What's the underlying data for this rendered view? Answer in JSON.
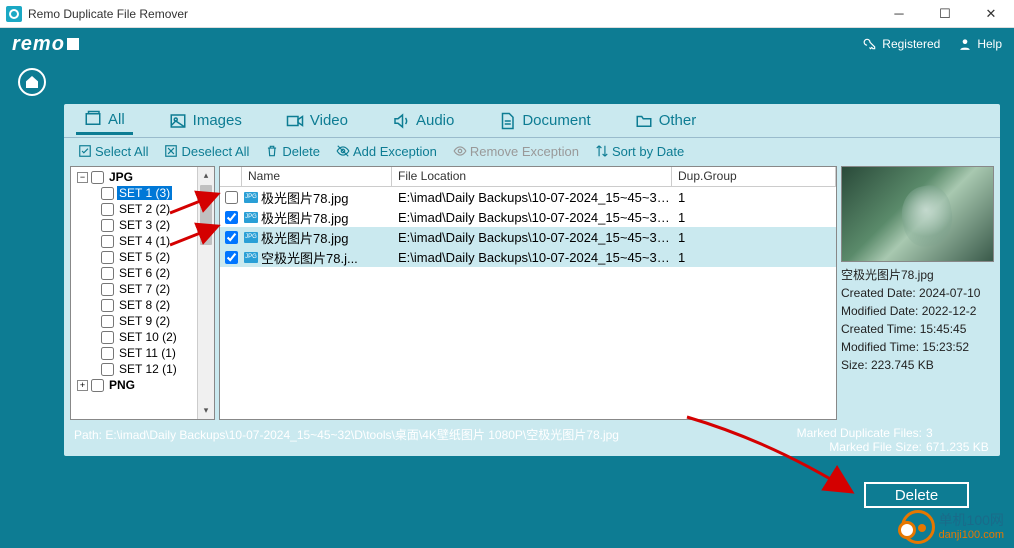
{
  "window": {
    "title": "Remo Duplicate File Remover"
  },
  "header": {
    "logo": "remo",
    "registered": "Registered",
    "help": "Help"
  },
  "tabs": {
    "all": "All",
    "images": "Images",
    "video": "Video",
    "audio": "Audio",
    "document": "Document",
    "other": "Other"
  },
  "toolbar": {
    "select_all": "Select All",
    "deselect_all": "Deselect All",
    "delete": "Delete",
    "add_exception": "Add Exception",
    "remove_exception": "Remove Exception",
    "sort_by_date": "Sort by Date"
  },
  "tree": {
    "root": "JPG",
    "items": [
      {
        "label": "SET 1 (3)",
        "selected": true
      },
      {
        "label": "SET 2 (2)"
      },
      {
        "label": "SET 3 (2)"
      },
      {
        "label": "SET 4 (1)"
      },
      {
        "label": "SET 5 (2)"
      },
      {
        "label": "SET 6 (2)"
      },
      {
        "label": "SET 7 (2)"
      },
      {
        "label": "SET 8 (2)"
      },
      {
        "label": "SET 9 (2)"
      },
      {
        "label": "SET 10 (2)"
      },
      {
        "label": "SET 11 (1)"
      },
      {
        "label": "SET 12 (1)"
      }
    ],
    "last": "PNG"
  },
  "filelist": {
    "headers": {
      "name": "Name",
      "location": "File Location",
      "group": "Dup.Group"
    },
    "rows": [
      {
        "checked": false,
        "name": "极光图片78.jpg",
        "loc": "E:\\imad\\Daily Backups\\10-07-2024_15~45~32\\...",
        "grp": "1",
        "sel": false
      },
      {
        "checked": true,
        "name": "极光图片78.jpg",
        "loc": "E:\\imad\\Daily Backups\\10-07-2024_15~45~32\\...",
        "grp": "1",
        "sel": false
      },
      {
        "checked": true,
        "name": "极光图片78.jpg",
        "loc": "E:\\imad\\Daily Backups\\10-07-2024_15~45~32\\...",
        "grp": "1",
        "sel": true
      },
      {
        "checked": true,
        "name": "空极光图片78.j...",
        "loc": "E:\\imad\\Daily Backups\\10-07-2024_15~45~32\\...",
        "grp": "1",
        "sel": true
      }
    ]
  },
  "preview": {
    "filename": "空极光图片78.jpg",
    "created_date": "Created Date: 2024-07-10",
    "modified_date": "Modified Date: 2022-12-2",
    "created_time": "Created Time: 15:45:45",
    "modified_time": "Modified Time: 15:23:52",
    "size": "Size: 223.745 KB"
  },
  "footer": {
    "path_label": "Path:",
    "path": "E:\\imad\\Daily Backups\\10-07-2024_15~45~32\\D\\tools\\桌面\\4K壁纸图片 1080P\\空极光图片78.jpg",
    "marked_files_label": "Marked Duplicate Files:",
    "marked_files": "3",
    "marked_size_label": "Marked File Size:",
    "marked_size": "671.235 KB"
  },
  "buttons": {
    "delete": "Delete"
  },
  "watermark": {
    "line1": "单机100网",
    "line2": "danji100.com"
  }
}
